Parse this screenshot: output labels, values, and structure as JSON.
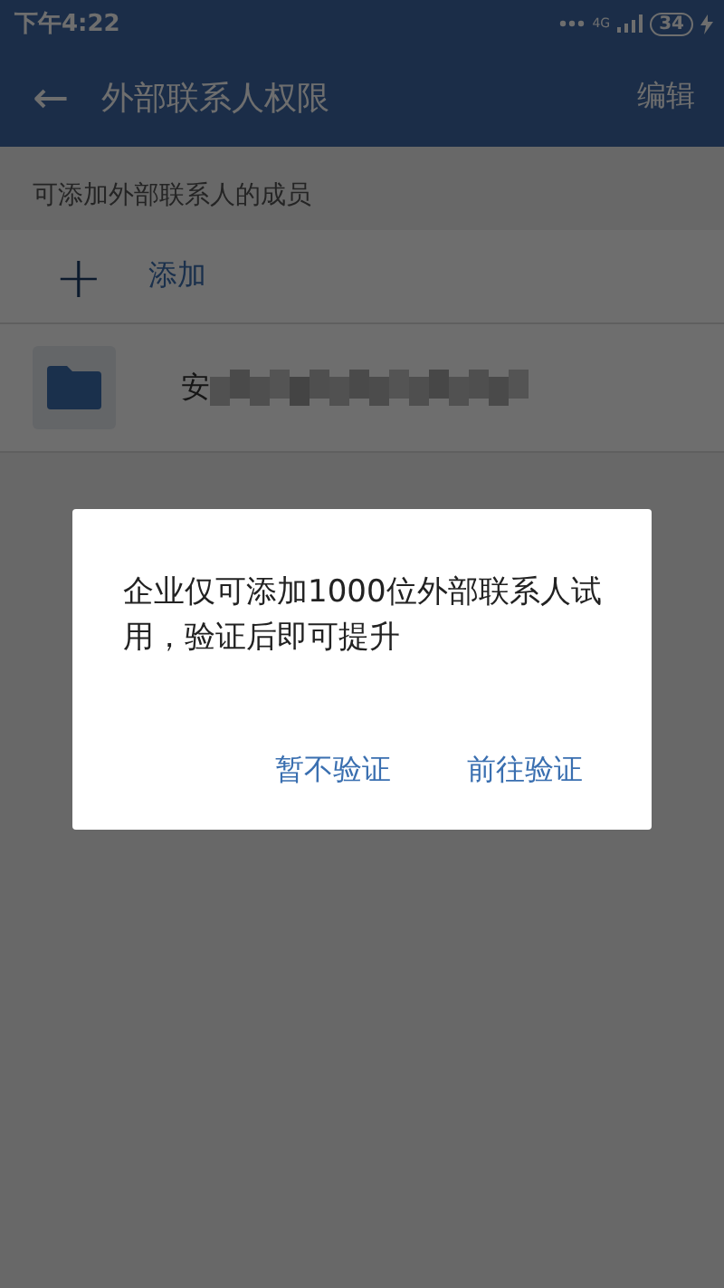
{
  "status_bar": {
    "time": "下午4:22",
    "network": "4G",
    "battery": "34",
    "charging": true
  },
  "app_bar": {
    "back": "←",
    "title": "外部联系人权限",
    "action": "编辑"
  },
  "section_header": "可添加外部联系人的成员",
  "add_row": {
    "icon": "+",
    "label": "添加"
  },
  "members": [
    {
      "kind": "folder",
      "name": "安"
    }
  ],
  "dialog": {
    "message": "企业仅可添加1000位外部联系人试用，验证后即可提升",
    "buttons": [
      {
        "label": "暂不验证"
      },
      {
        "label": "前往验证"
      }
    ]
  }
}
